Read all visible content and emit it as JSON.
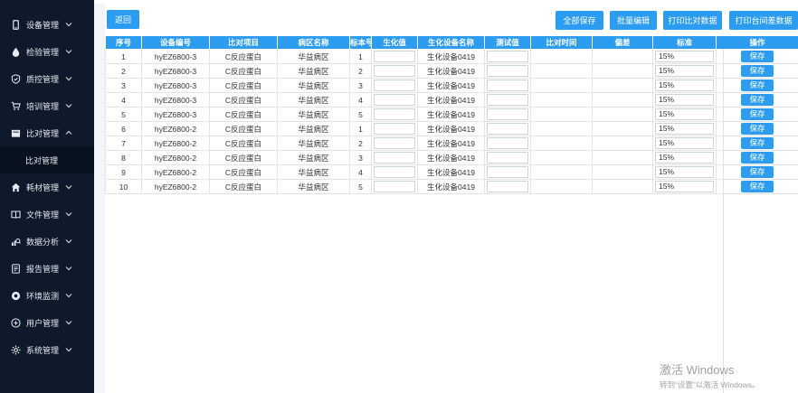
{
  "sidebar": {
    "items": [
      {
        "label": "设备管理",
        "icon": "phone-icon",
        "expand": "down"
      },
      {
        "label": "检验管理",
        "icon": "drop-icon",
        "expand": "down"
      },
      {
        "label": "质控管理",
        "icon": "shield-check-icon",
        "expand": "down"
      },
      {
        "label": "培训管理",
        "icon": "cart-icon",
        "expand": "down"
      },
      {
        "label": "比对管理",
        "icon": "folder-icon",
        "expand": "up"
      },
      {
        "label": "耗材管理",
        "icon": "home-icon",
        "expand": "down"
      },
      {
        "label": "文件管理",
        "icon": "book-icon",
        "expand": "down"
      },
      {
        "label": "数据分析",
        "icon": "analytics-icon",
        "expand": "down"
      },
      {
        "label": "报告管理",
        "icon": "report-icon",
        "expand": "down"
      },
      {
        "label": "环境监测",
        "icon": "monitor-icon",
        "expand": "down"
      },
      {
        "label": "用户管理",
        "icon": "user-icon",
        "expand": "down"
      },
      {
        "label": "系统管理",
        "icon": "gear-icon",
        "expand": "down"
      }
    ],
    "active_sub": "比对管理"
  },
  "toolbar": {
    "back": "返回",
    "save_all": "全部保存",
    "batch_edit": "批量编辑",
    "print_compare": "打印比对数据",
    "print_diff": "打印台间差数据"
  },
  "table": {
    "headers": [
      "序号",
      "设备编号",
      "比对项目",
      "病区名称",
      "标本号",
      "生化值",
      "生化设备名称",
      "测试值",
      "比对时间",
      "偏差",
      "标准",
      "操作"
    ],
    "save_label": "保存",
    "rows": [
      {
        "no": "1",
        "device": "hyEZ6800-3",
        "item": "C反应蛋白",
        "ward": "华益病区",
        "sample": "1",
        "bio_value": "",
        "bio_device": "生化设备0419",
        "test_value": "",
        "time": "",
        "deviation": "",
        "standard": "15%"
      },
      {
        "no": "2",
        "device": "hyEZ6800-3",
        "item": "C反应蛋白",
        "ward": "华益病区",
        "sample": "2",
        "bio_value": "",
        "bio_device": "生化设备0419",
        "test_value": "",
        "time": "",
        "deviation": "",
        "standard": "15%"
      },
      {
        "no": "3",
        "device": "hyEZ6800-3",
        "item": "C反应蛋白",
        "ward": "华益病区",
        "sample": "3",
        "bio_value": "",
        "bio_device": "生化设备0419",
        "test_value": "",
        "time": "",
        "deviation": "",
        "standard": "15%"
      },
      {
        "no": "4",
        "device": "hyEZ6800-3",
        "item": "C反应蛋白",
        "ward": "华益病区",
        "sample": "4",
        "bio_value": "",
        "bio_device": "生化设备0419",
        "test_value": "",
        "time": "",
        "deviation": "",
        "standard": "15%"
      },
      {
        "no": "5",
        "device": "hyEZ6800-3",
        "item": "C反应蛋白",
        "ward": "华益病区",
        "sample": "5",
        "bio_value": "",
        "bio_device": "生化设备0419",
        "test_value": "",
        "time": "",
        "deviation": "",
        "standard": "15%"
      },
      {
        "no": "6",
        "device": "hyEZ6800-2",
        "item": "C反应蛋白",
        "ward": "华益病区",
        "sample": "1",
        "bio_value": "",
        "bio_device": "生化设备0419",
        "test_value": "",
        "time": "",
        "deviation": "",
        "standard": "15%"
      },
      {
        "no": "7",
        "device": "hyEZ6800-2",
        "item": "C反应蛋白",
        "ward": "华益病区",
        "sample": "2",
        "bio_value": "",
        "bio_device": "生化设备0419",
        "test_value": "",
        "time": "",
        "deviation": "",
        "standard": "15%"
      },
      {
        "no": "8",
        "device": "hyEZ6800-2",
        "item": "C反应蛋白",
        "ward": "华益病区",
        "sample": "3",
        "bio_value": "",
        "bio_device": "生化设备0419",
        "test_value": "",
        "time": "",
        "deviation": "",
        "standard": "15%"
      },
      {
        "no": "9",
        "device": "hyEZ6800-2",
        "item": "C反应蛋白",
        "ward": "华益病区",
        "sample": "4",
        "bio_value": "",
        "bio_device": "生化设备0419",
        "test_value": "",
        "time": "",
        "deviation": "",
        "standard": "15%"
      },
      {
        "no": "10",
        "device": "hyEZ6800-2",
        "item": "C反应蛋白",
        "ward": "华益病区",
        "sample": "5",
        "bio_value": "",
        "bio_device": "生化设备0419",
        "test_value": "",
        "time": "",
        "deviation": "",
        "standard": "15%"
      }
    ]
  },
  "watermark": {
    "title": "激活 Windows",
    "subtitle": "转到“设置”以激活 Windows。"
  },
  "colors": {
    "sidebar_bg": "#0e1a2b",
    "primary": "#2c9cf0"
  }
}
